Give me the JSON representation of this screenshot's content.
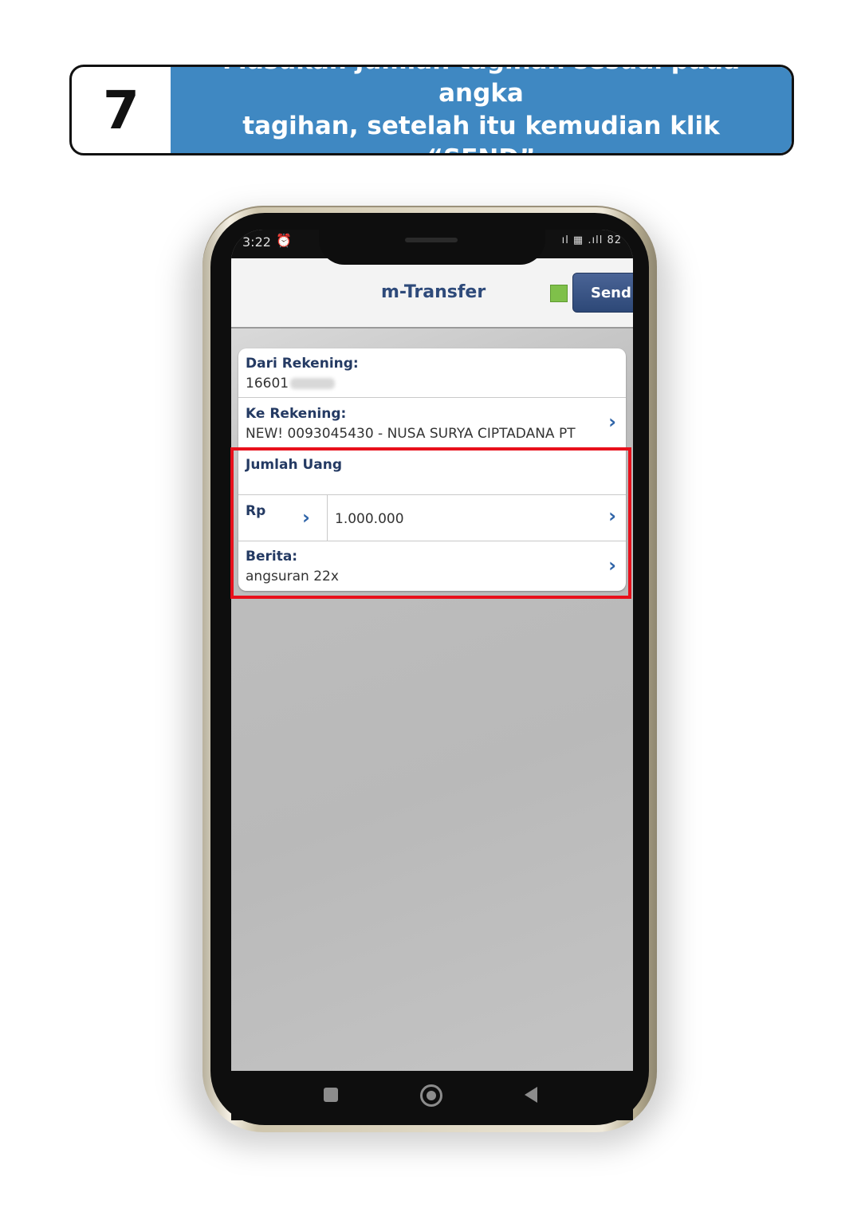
{
  "banner": {
    "step": "7",
    "line1": "Masukan jumlah tagihan sesuai pada angka",
    "line2": "tagihan, setelah itu kemudian klik “SEND”"
  },
  "status": {
    "time": "3:22",
    "icons": "ıl ▦ .ıll 82"
  },
  "app": {
    "title": "m-Transfer",
    "send_label": "Send"
  },
  "form": {
    "dari_label": "Dari Rekening:",
    "dari_value": "16601",
    "ke_label": "Ke Rekening:",
    "ke_value": "NEW! 0093045430 - NUSA SURYA CIPTADANA PT",
    "jumlah_label": "Jumlah Uang",
    "currency": "Rp",
    "amount": "1.000.000",
    "berita_label": "Berita:",
    "berita_value": "angsuran 22x"
  },
  "colors": {
    "banner_blue": "#3f88c2",
    "highlight_red": "#e8101b",
    "label_navy": "#243a63",
    "chevron_blue": "#2f64a8"
  },
  "icons": {
    "chevron": "›",
    "alarm": "alarm-icon"
  }
}
